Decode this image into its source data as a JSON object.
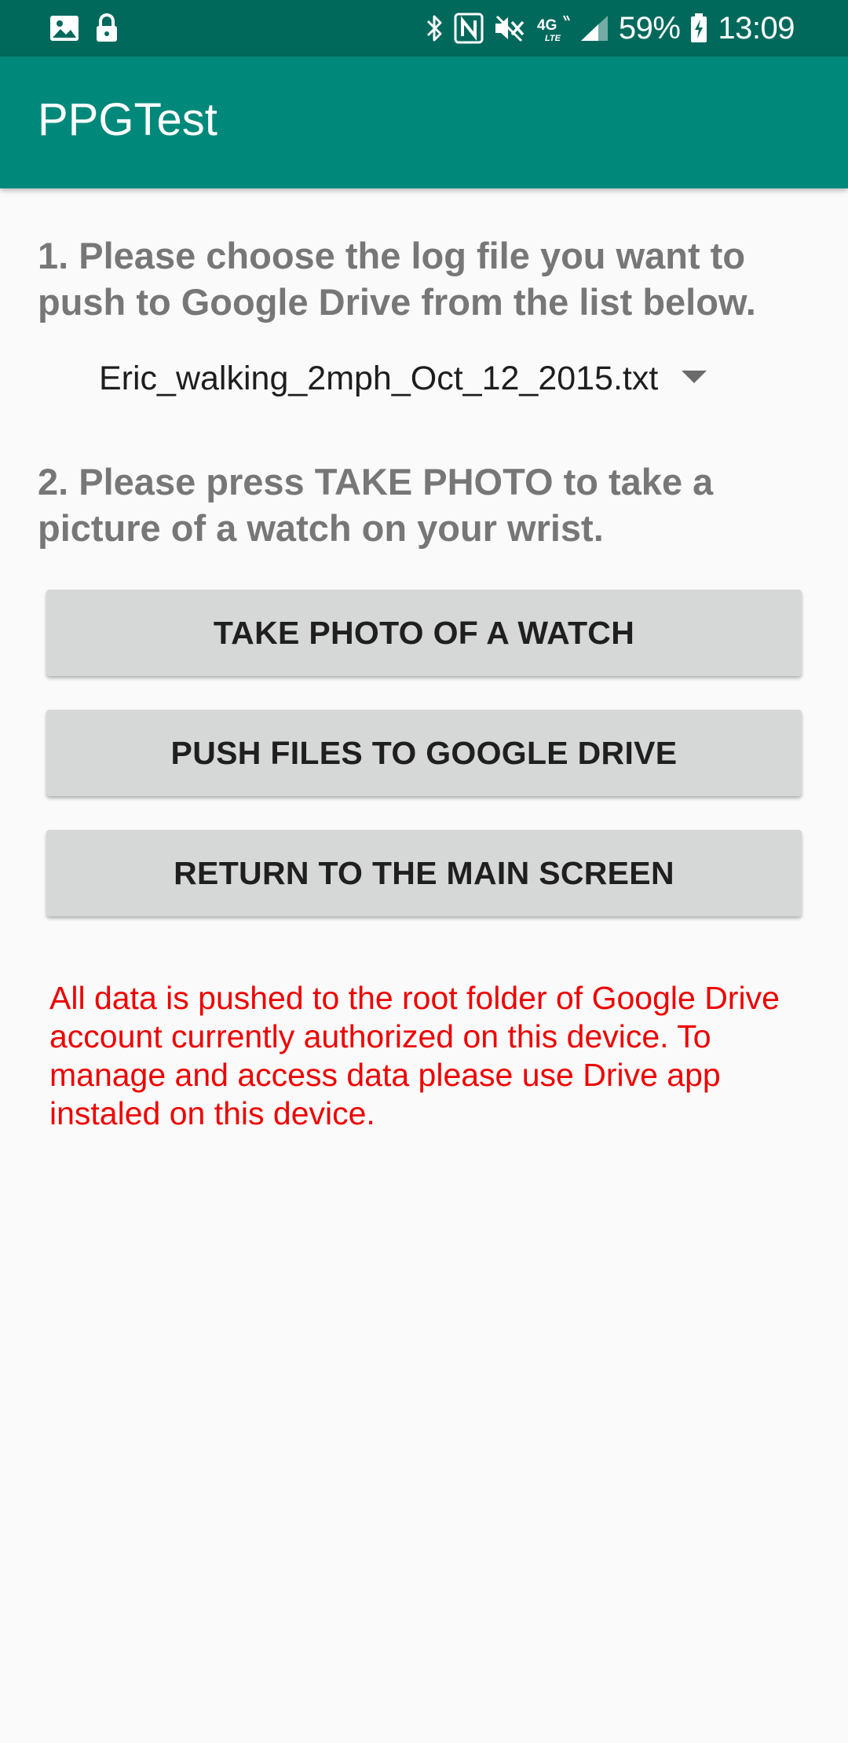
{
  "status_bar": {
    "battery_percent": "59%",
    "time": "13:09",
    "icons": [
      "image-icon",
      "lock-icon",
      "bluetooth-icon",
      "nfc-icon",
      "mute-icon",
      "4g-lte-icon",
      "signal-icon",
      "battery-charging-icon"
    ],
    "network_label": "4G"
  },
  "app_bar": {
    "title": "PPGTest"
  },
  "main": {
    "instruction_1": "1. Please choose the log file you want to push to Google Drive from the list below.",
    "spinner": {
      "selected_value": "Eric_walking_2mph_Oct_12_2015.txt"
    },
    "instruction_2": "2. Please press TAKE PHOTO to take a picture of a watch on your wrist.",
    "buttons": {
      "take_photo": "TAKE PHOTO OF A WATCH",
      "push_files": "PUSH FILES TO GOOGLE DRIVE",
      "return_main": "RETURN TO THE MAIN SCREEN"
    },
    "notice": "All data is pushed to the root folder of Google Drive account currently authorized on this device. To manage and access data please use Drive app instaled on this device."
  },
  "colors": {
    "status_bar": "#00695c",
    "app_bar": "#00897b",
    "background": "#fafafa",
    "button": "#d6d7d7",
    "instruction_text": "#777777",
    "notice_text": "#ee0000"
  }
}
